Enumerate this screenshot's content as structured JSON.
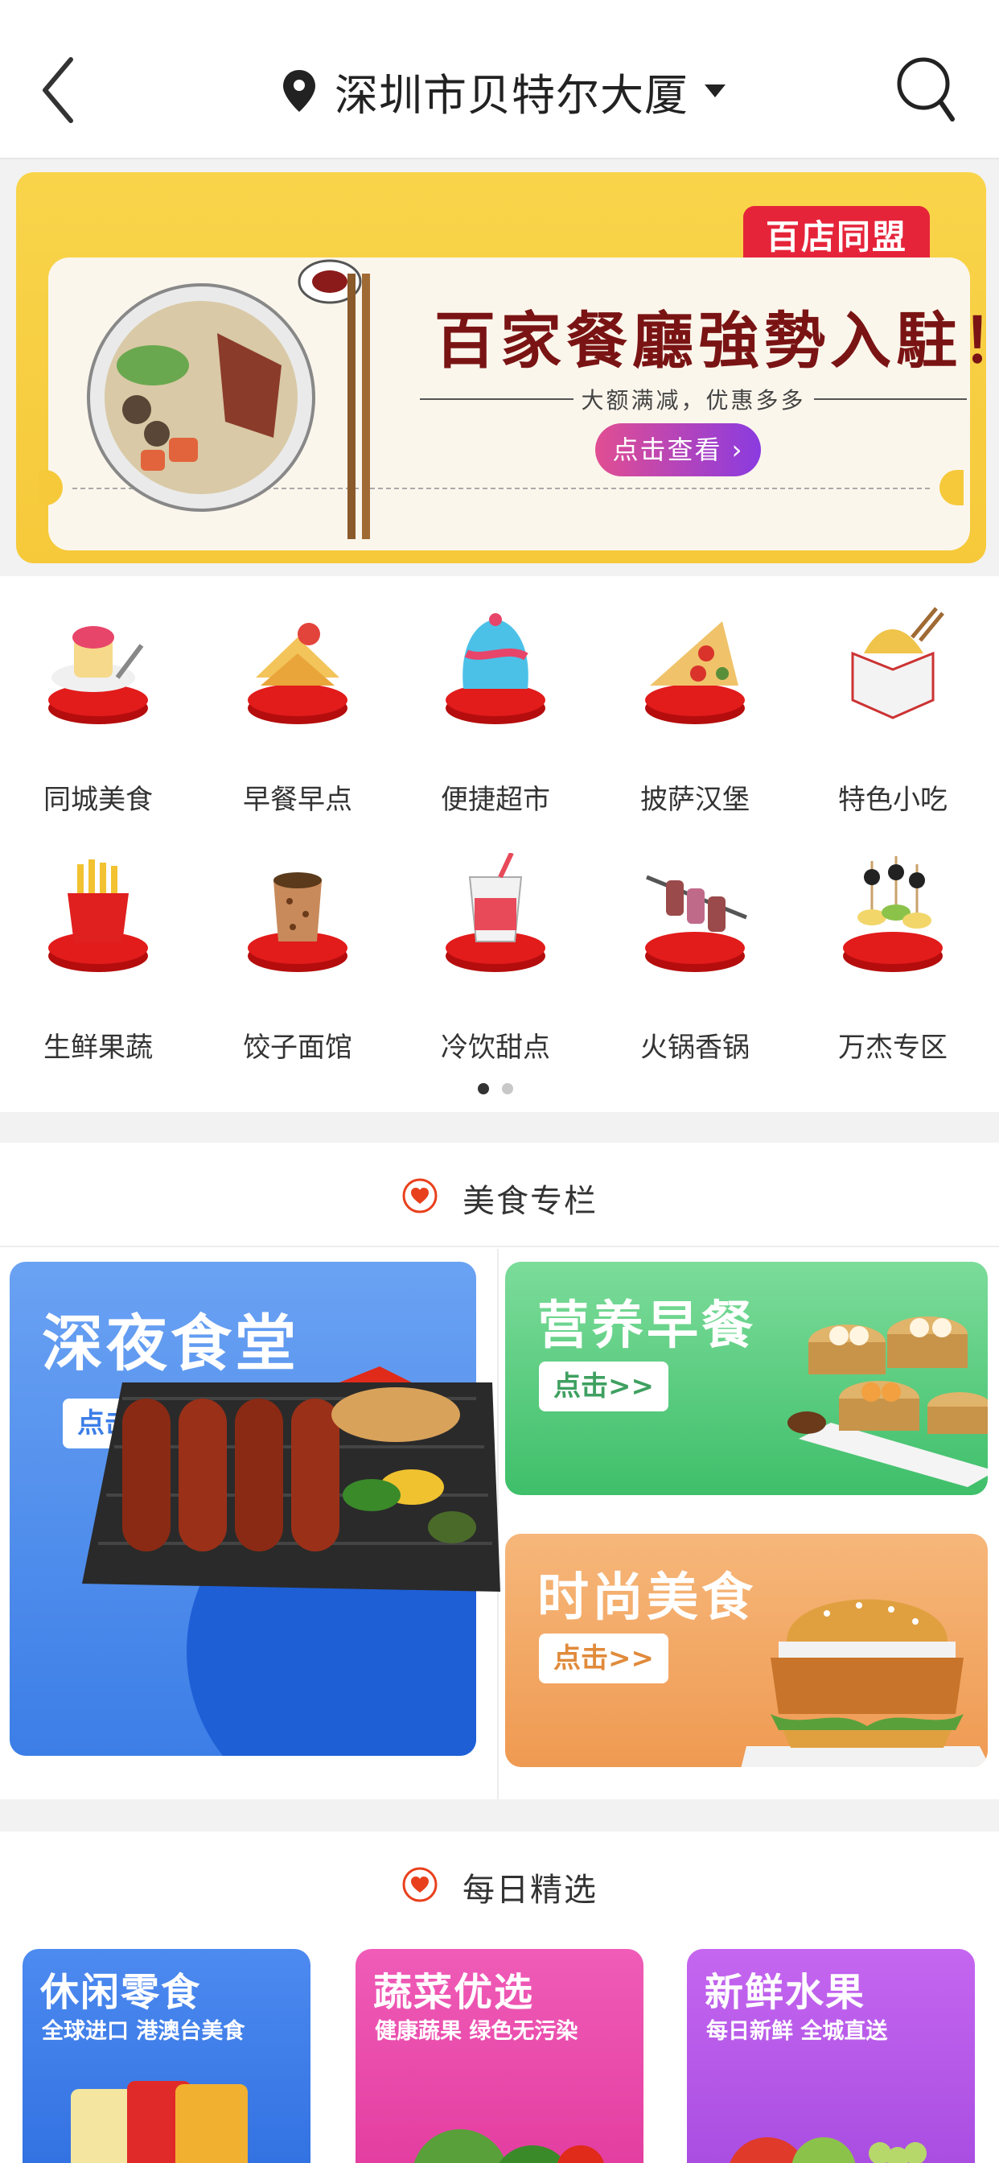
{
  "header": {
    "back_icon": "back-chevron-icon",
    "location_icon": "location-pin-icon",
    "location": "深圳市贝特尔大厦",
    "dropdown_icon": "caret-down-icon",
    "search_icon": "search-icon"
  },
  "banner": {
    "badge": "百店同盟",
    "title": "百家餐廳強勢入駐！",
    "subtitle": "大额满减，优惠多多",
    "button": "点击查看 ›"
  },
  "categories": [
    {
      "label": "同城美食",
      "icon": "cake-icon"
    },
    {
      "label": "早餐早点",
      "icon": "sandwich-icon"
    },
    {
      "label": "便捷超市",
      "icon": "dessert-icon"
    },
    {
      "label": "披萨汉堡",
      "icon": "pizza-icon"
    },
    {
      "label": "特色小吃",
      "icon": "snack-box-icon"
    },
    {
      "label": "生鲜果蔬",
      "icon": "fries-icon"
    },
    {
      "label": "饺子面馆",
      "icon": "coffee-cup-icon"
    },
    {
      "label": "冷饮甜点",
      "icon": "cold-drink-icon"
    },
    {
      "label": "火锅香锅",
      "icon": "skewer-icon"
    },
    {
      "label": "万杰专区",
      "icon": "canape-icon"
    }
  ],
  "carousel": {
    "pages": 2,
    "active": 1
  },
  "food_section": {
    "title": "美食专栏",
    "icon": "heart-icon",
    "cards": [
      {
        "title": "深夜食堂",
        "button": "点击>>"
      },
      {
        "title": "营养早餐",
        "button": "点击>>"
      },
      {
        "title": "时尚美食",
        "button": "点击>>"
      }
    ]
  },
  "daily_section": {
    "title": "每日精选",
    "icon": "heart-icon",
    "cards": [
      {
        "title": "休闲零食",
        "subtitle": "全球进口 港澳台美食"
      },
      {
        "title": "蔬菜优选",
        "subtitle": "健康蔬果  绿色无污染"
      },
      {
        "title": "新鲜水果",
        "subtitle": "每日新鲜 全城直送"
      }
    ]
  },
  "colors": {
    "accent": "#e8401c",
    "banner_bg": "#f6c93a",
    "night_card": "#3c7ee7",
    "breakfast_card": "#3fbf6a",
    "fashion_card": "#f09a55",
    "snack_card": "#2f6fe0",
    "veg_card": "#e83fa8",
    "fruit_card": "#b54be8"
  }
}
